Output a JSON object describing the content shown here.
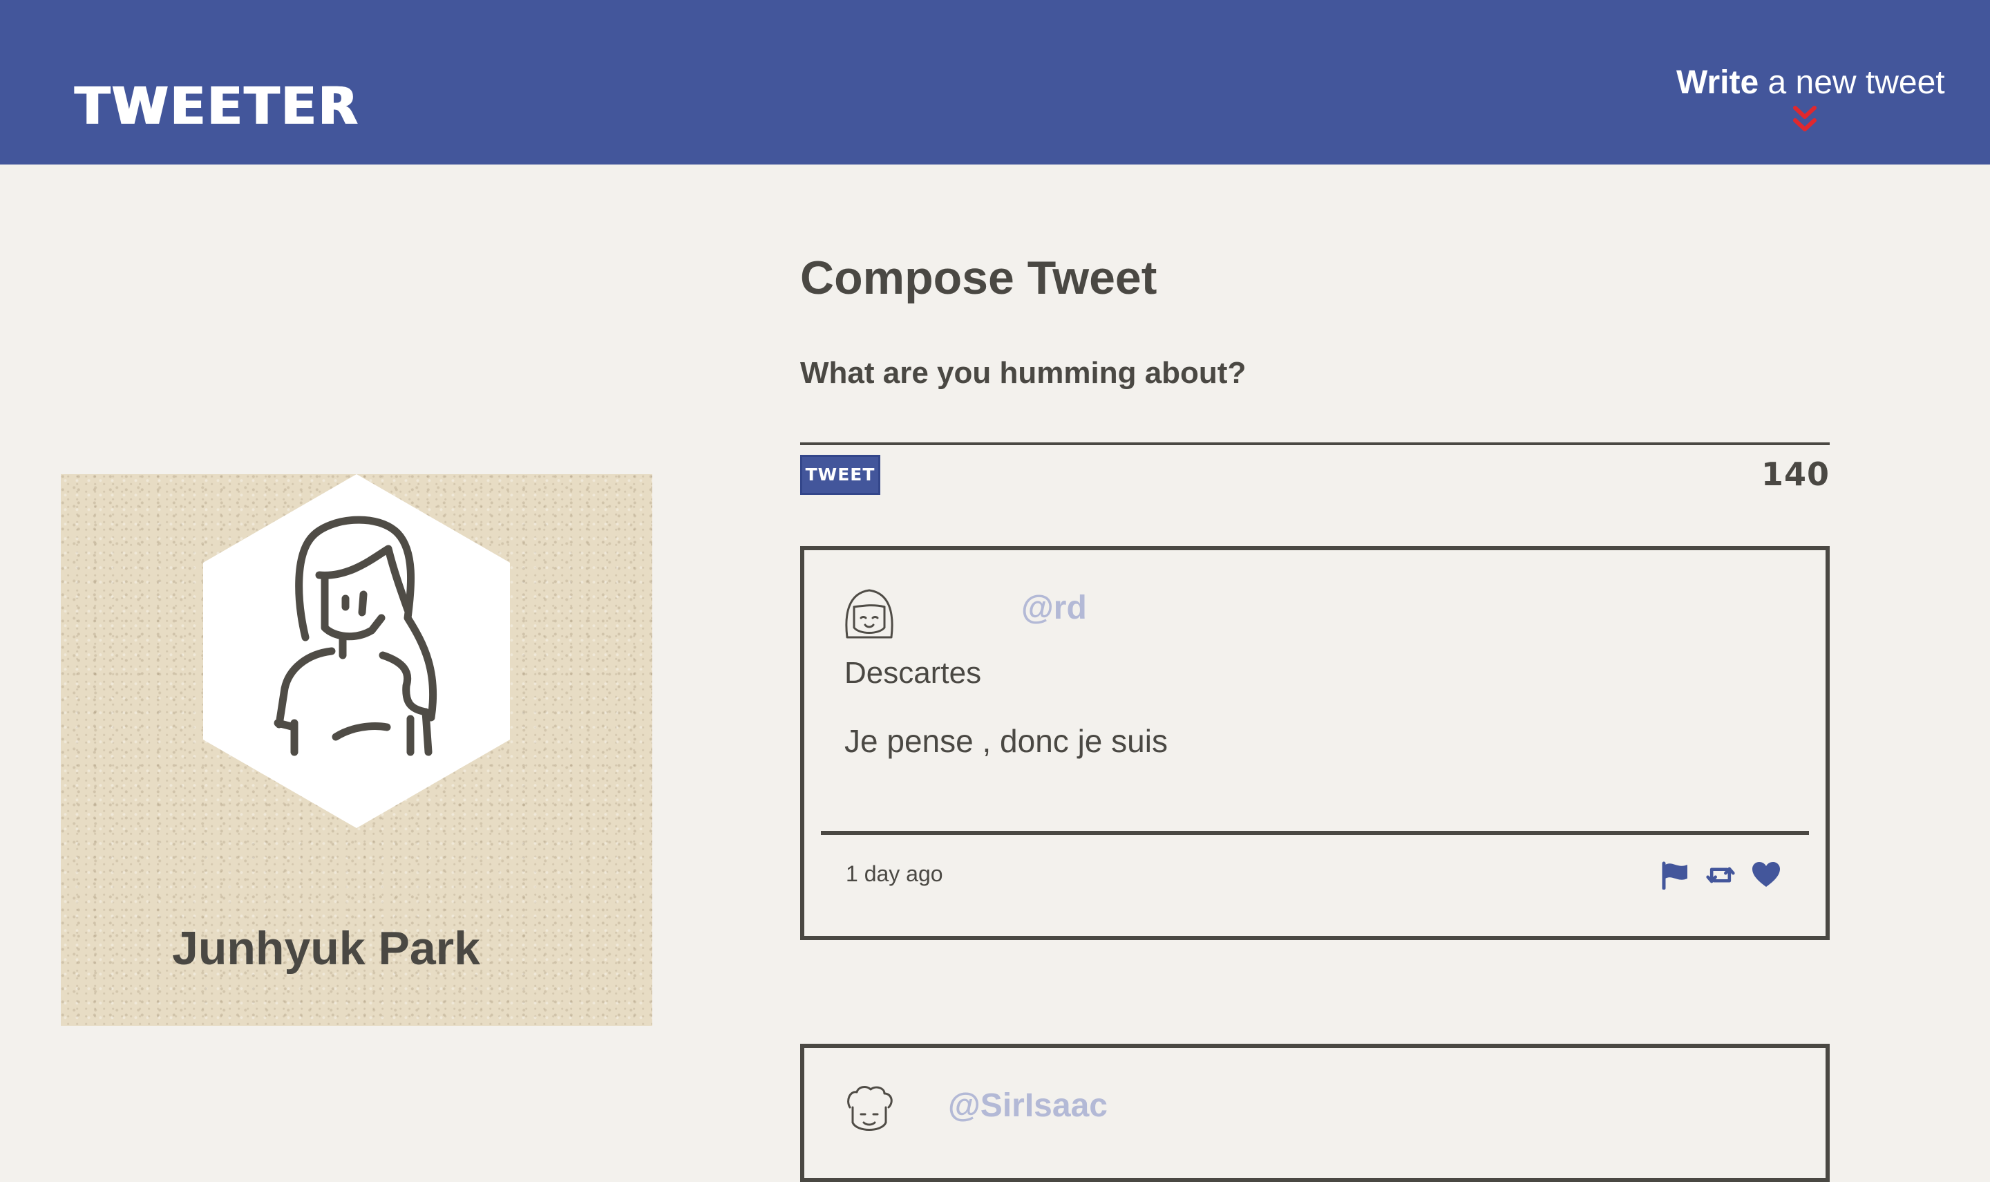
{
  "nav": {
    "brand": "TWEETER",
    "compose_toggle": {
      "bold": "Write",
      "rest": " a new tweet"
    }
  },
  "profile": {
    "name": "Junhyuk Park"
  },
  "compose": {
    "title": "Compose Tweet",
    "placeholder": "What are you humming about?",
    "button_label": "TWEET",
    "counter": "140"
  },
  "tweets": [
    {
      "handle": "@rd",
      "name": "Descartes",
      "content": "Je pense , donc je suis",
      "time": "1 day ago"
    },
    {
      "handle": "@SirIsaac"
    }
  ],
  "colors": {
    "nav_bg": "#43569b",
    "page_bg": "#f3f1ed",
    "text": "#4a4843",
    "handle": "#b3b9d6",
    "chevron": "#e0282e",
    "profile_bg": "#e7dcc4"
  },
  "icons": {
    "chevron": "double-chevron-down-icon",
    "flag": "flag-icon",
    "retweet": "retweet-icon",
    "like": "heart-icon"
  }
}
